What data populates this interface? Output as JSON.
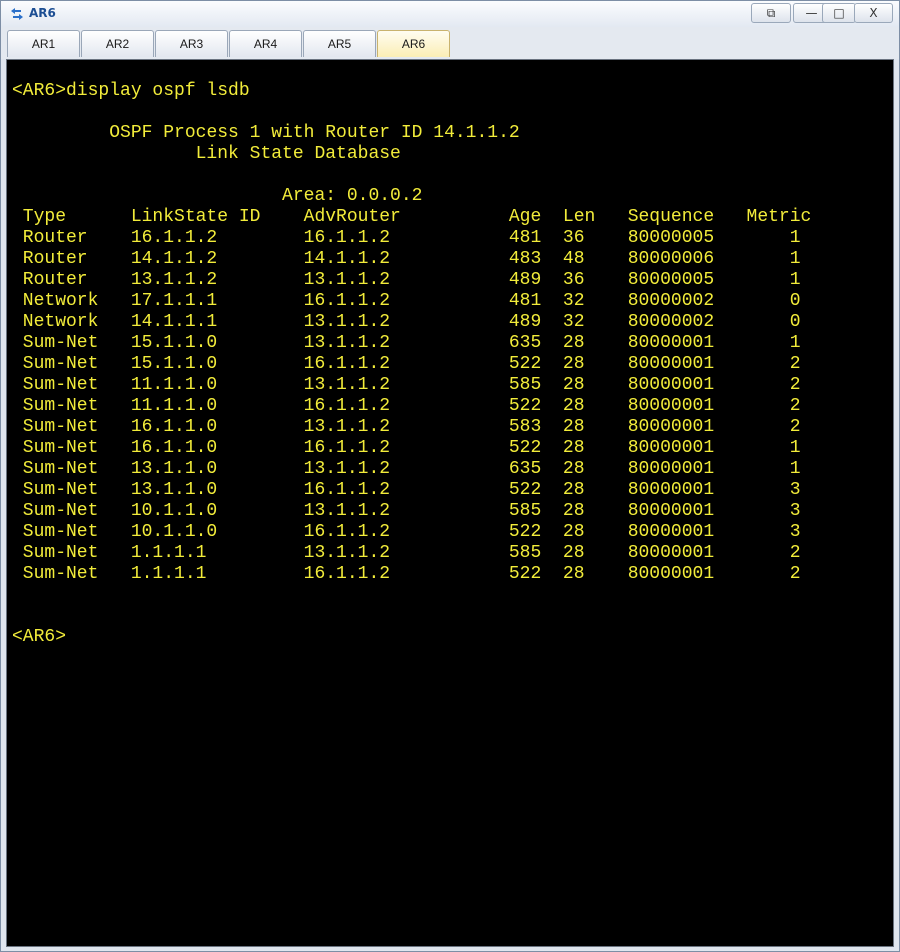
{
  "window": {
    "title": "AR6",
    "controls": {
      "restore": "⧉",
      "minimize": "—",
      "maximize": "□",
      "close": "X"
    }
  },
  "tabs": [
    {
      "label": "AR1",
      "active": false
    },
    {
      "label": "AR2",
      "active": false
    },
    {
      "label": "AR3",
      "active": false
    },
    {
      "label": "AR4",
      "active": false
    },
    {
      "label": "AR5",
      "active": false
    },
    {
      "label": "AR6",
      "active": true
    }
  ],
  "terminal": {
    "colors": {
      "background": "#000000",
      "text": "#f2ec3a"
    },
    "lines": [
      "<AR6>display ospf lsdb",
      "",
      "\t OSPF Process 1 with Router ID 14.1.1.2",
      "\t\t Link State Database",
      "",
      "\t\t         Area: 0.0.0.2",
      " Type      LinkState ID    AdvRouter          Age  Len   Sequence   Metric",
      " Router    16.1.1.2        16.1.1.2           481  36    80000005       1",
      " Router    14.1.1.2        14.1.1.2           483  48    80000006       1",
      " Router    13.1.1.2        13.1.1.2           489  36    80000005       1",
      " Network   17.1.1.1        16.1.1.2           481  32    80000002       0",
      " Network   14.1.1.1        13.1.1.2           489  32    80000002       0",
      " Sum-Net   15.1.1.0        13.1.1.2           635  28    80000001       1",
      " Sum-Net   15.1.1.0        16.1.1.2           522  28    80000001       2",
      " Sum-Net   11.1.1.0        13.1.1.2           585  28    80000001       2",
      " Sum-Net   11.1.1.0        16.1.1.2           522  28    80000001       2",
      " Sum-Net   16.1.1.0        13.1.1.2           583  28    80000001       2",
      " Sum-Net   16.1.1.0        16.1.1.2           522  28    80000001       1",
      " Sum-Net   13.1.1.0        13.1.1.2           635  28    80000001       1",
      " Sum-Net   13.1.1.0        16.1.1.2           522  28    80000001       3",
      " Sum-Net   10.1.1.0        13.1.1.2           585  28    80000001       3",
      " Sum-Net   10.1.1.0        16.1.1.2           522  28    80000001       3",
      " Sum-Net   1.1.1.1         13.1.1.2           585  28    80000001       2",
      " Sum-Net   1.1.1.1         16.1.1.2           522  28    80000001       2",
      "",
      "",
      "<AR6>"
    ]
  }
}
